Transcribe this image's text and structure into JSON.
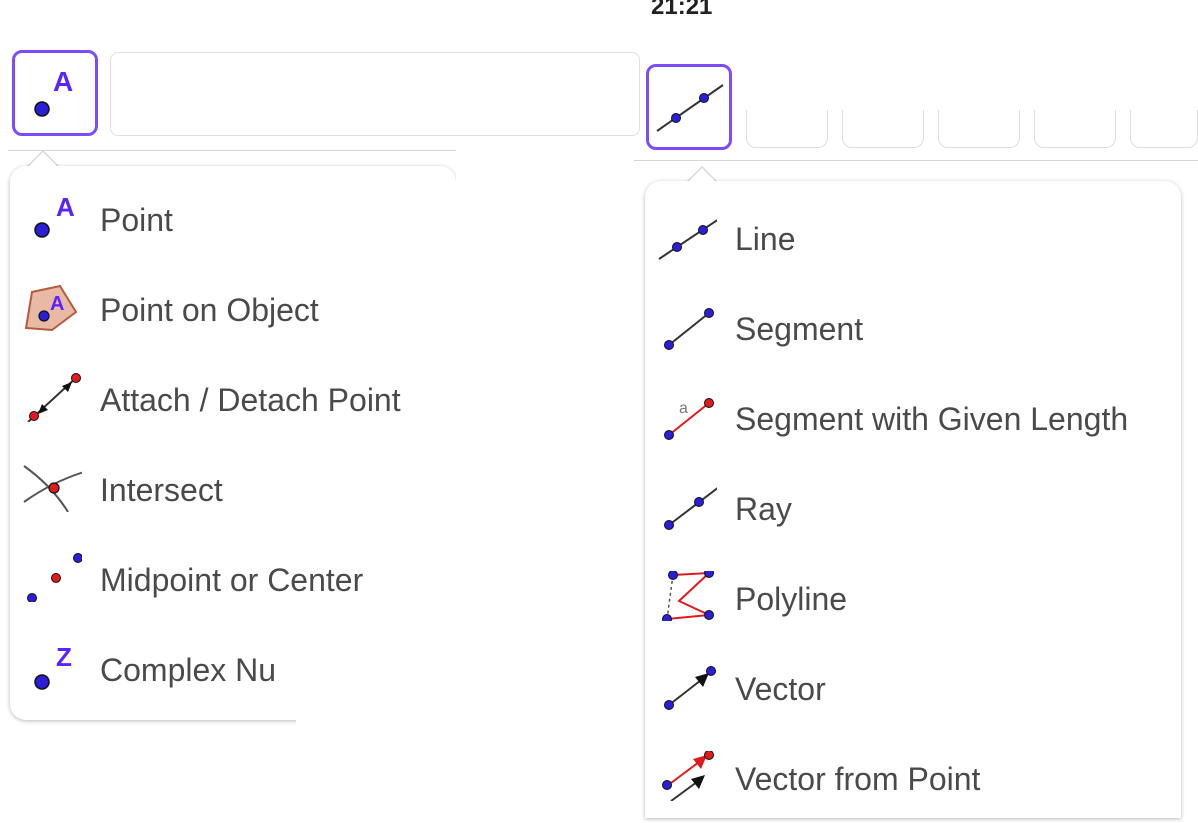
{
  "status": {
    "time": "21:21"
  },
  "left_menu": {
    "items": [
      {
        "label": "Point",
        "icon": "point-icon"
      },
      {
        "label": "Point on Object",
        "icon": "point-on-object-icon"
      },
      {
        "label": "Attach / Detach Point",
        "icon": "attach-detach-point-icon"
      },
      {
        "label": "Intersect",
        "icon": "intersect-icon"
      },
      {
        "label": "Midpoint or Center",
        "icon": "midpoint-icon"
      },
      {
        "label": "Complex Nu",
        "icon": "complex-number-icon"
      }
    ]
  },
  "right_menu": {
    "items": [
      {
        "label": "Line",
        "icon": "line-icon"
      },
      {
        "label": "Segment",
        "icon": "segment-icon"
      },
      {
        "label": "Segment with Given Length",
        "icon": "segment-given-length-icon"
      },
      {
        "label": "Ray",
        "icon": "ray-icon"
      },
      {
        "label": "Polyline",
        "icon": "polyline-icon"
      },
      {
        "label": "Vector",
        "icon": "vector-icon"
      },
      {
        "label": "Vector from Point",
        "icon": "vector-from-point-icon"
      }
    ]
  },
  "colors": {
    "accent": "#7c4dff",
    "point_blue": "#2a1fd6",
    "point_red": "#e01b1b",
    "label_letter": "#5a22ff"
  }
}
